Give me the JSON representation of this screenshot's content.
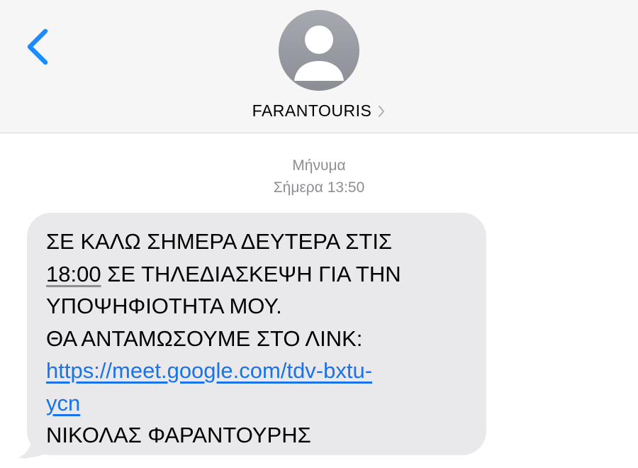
{
  "header": {
    "contact_name": "FARANTOURIS",
    "icons": {
      "back": "chevron-left-icon",
      "avatar": "person-silhouette-icon",
      "details": "chevron-right-icon"
    },
    "colors": {
      "accent": "#1a8cff",
      "avatar": "#9a9ca4",
      "background": "#f6f6f6"
    }
  },
  "conversation": {
    "service_label": "Μήνυμα",
    "timestamp": "Σήμερα 13:50",
    "message": {
      "line1": "ΣΕ ΚΑΛΩ ΣΗΜΕΡΑ ΔΕΥΤΕΡΑ ΣΤΙΣ",
      "line2_time": "18:00",
      "line2_rest": " ΣΕ ΤΗΛΕΔΙΑΣΚΕΨΗ ΓΙΑ ΤΗΝ",
      "line3": "ΥΠΟΨΗΦΙΟΤΗΤΑ ΜΟΥ.",
      "line4": "ΘΑ ΑΝΤΑΜΩΣΟΥΜΕ ΣΤΟ ΛΙΝΚ:",
      "link_part1": "https://meet.google.com/tdv-bxtu-",
      "link_part2": "ycn",
      "signature": "ΝΙΚΟΛΑΣ ΦΑΡΑΝΤΟΥΡΗΣ"
    },
    "colors": {
      "bubble": "#e9e9eb",
      "link": "#1a73e8",
      "meta_text": "#8e8e93"
    }
  }
}
